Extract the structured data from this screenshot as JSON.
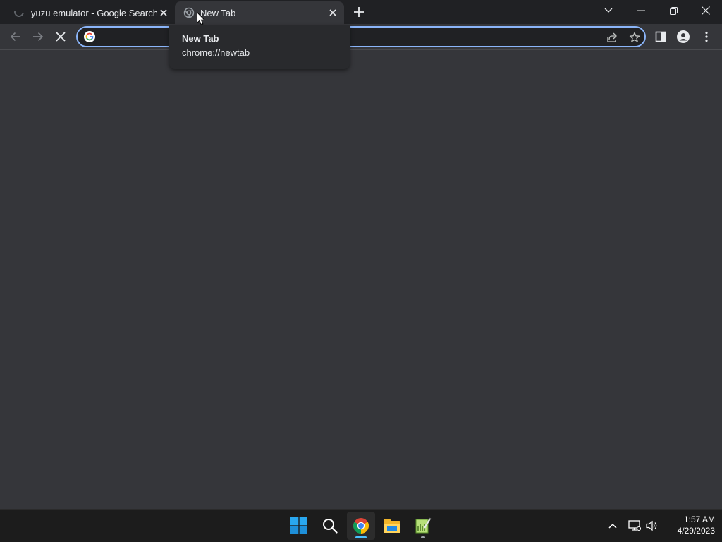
{
  "tabs": [
    {
      "title": "yuzu emulator - Google Search",
      "state": "loading"
    },
    {
      "title": "New Tab",
      "state": "active"
    }
  ],
  "tooltip": {
    "title": "New Tab",
    "url": "chrome://newtab"
  },
  "omnibox": {
    "value": "",
    "placeholder": ""
  },
  "taskbar": {
    "apps": [
      {
        "name": "Start",
        "icon": "windows-logo-icon"
      },
      {
        "name": "Search",
        "icon": "search-icon"
      },
      {
        "name": "Google Chrome",
        "icon": "chrome-icon",
        "active": true
      },
      {
        "name": "File Explorer",
        "icon": "folder-icon"
      },
      {
        "name": "Notepad++",
        "icon": "notepad-plus-plus-icon",
        "running": true
      }
    ],
    "clock": {
      "time": "1:57 AM",
      "date": "4/29/2023"
    }
  },
  "colors": {
    "accent": "#8ab4f8",
    "tabstrip": "#202124",
    "toolbar": "#35363a",
    "taskbar": "#1c1c1c",
    "chrome_indicator": "#4cc2ff"
  }
}
